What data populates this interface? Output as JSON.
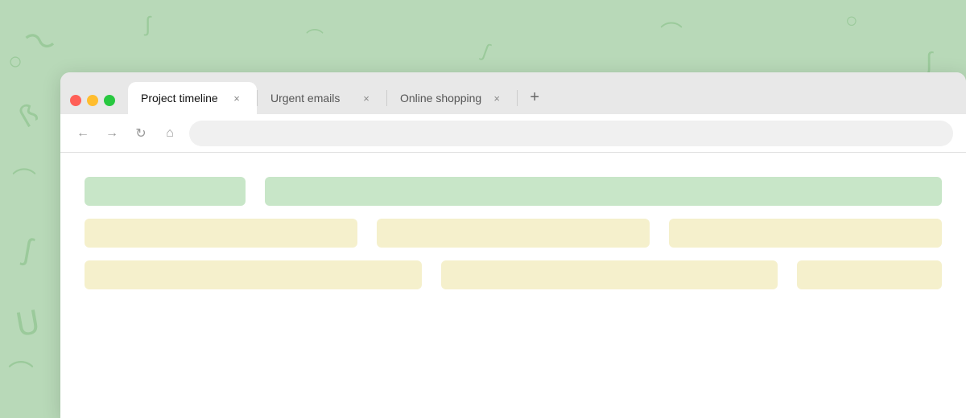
{
  "background": {
    "color": "#b8d9b8",
    "shape_color": "#8fc48f"
  },
  "browser": {
    "tabs": [
      {
        "id": "tab-1",
        "label": "Project timeline",
        "active": true
      },
      {
        "id": "tab-2",
        "label": "Urgent emails",
        "active": false
      },
      {
        "id": "tab-3",
        "label": "Online shopping",
        "active": false
      }
    ],
    "close_label": "×",
    "new_tab_label": "+",
    "nav": {
      "back": "←",
      "forward": "→",
      "reload": "↻",
      "home": "⌂"
    },
    "address_bar_placeholder": ""
  },
  "content": {
    "rows": [
      {
        "blocks": [
          {
            "type": "green",
            "span": "short"
          },
          {
            "type": "green",
            "span": "long"
          }
        ]
      },
      {
        "blocks": [
          {
            "type": "yellow",
            "span": "medium"
          },
          {
            "type": "yellow",
            "span": "medium"
          },
          {
            "type": "yellow",
            "span": "medium"
          }
        ]
      },
      {
        "blocks": [
          {
            "type": "yellow",
            "span": "medium"
          },
          {
            "type": "yellow",
            "span": "medium"
          },
          {
            "type": "yellow",
            "span": "short"
          }
        ]
      }
    ]
  }
}
